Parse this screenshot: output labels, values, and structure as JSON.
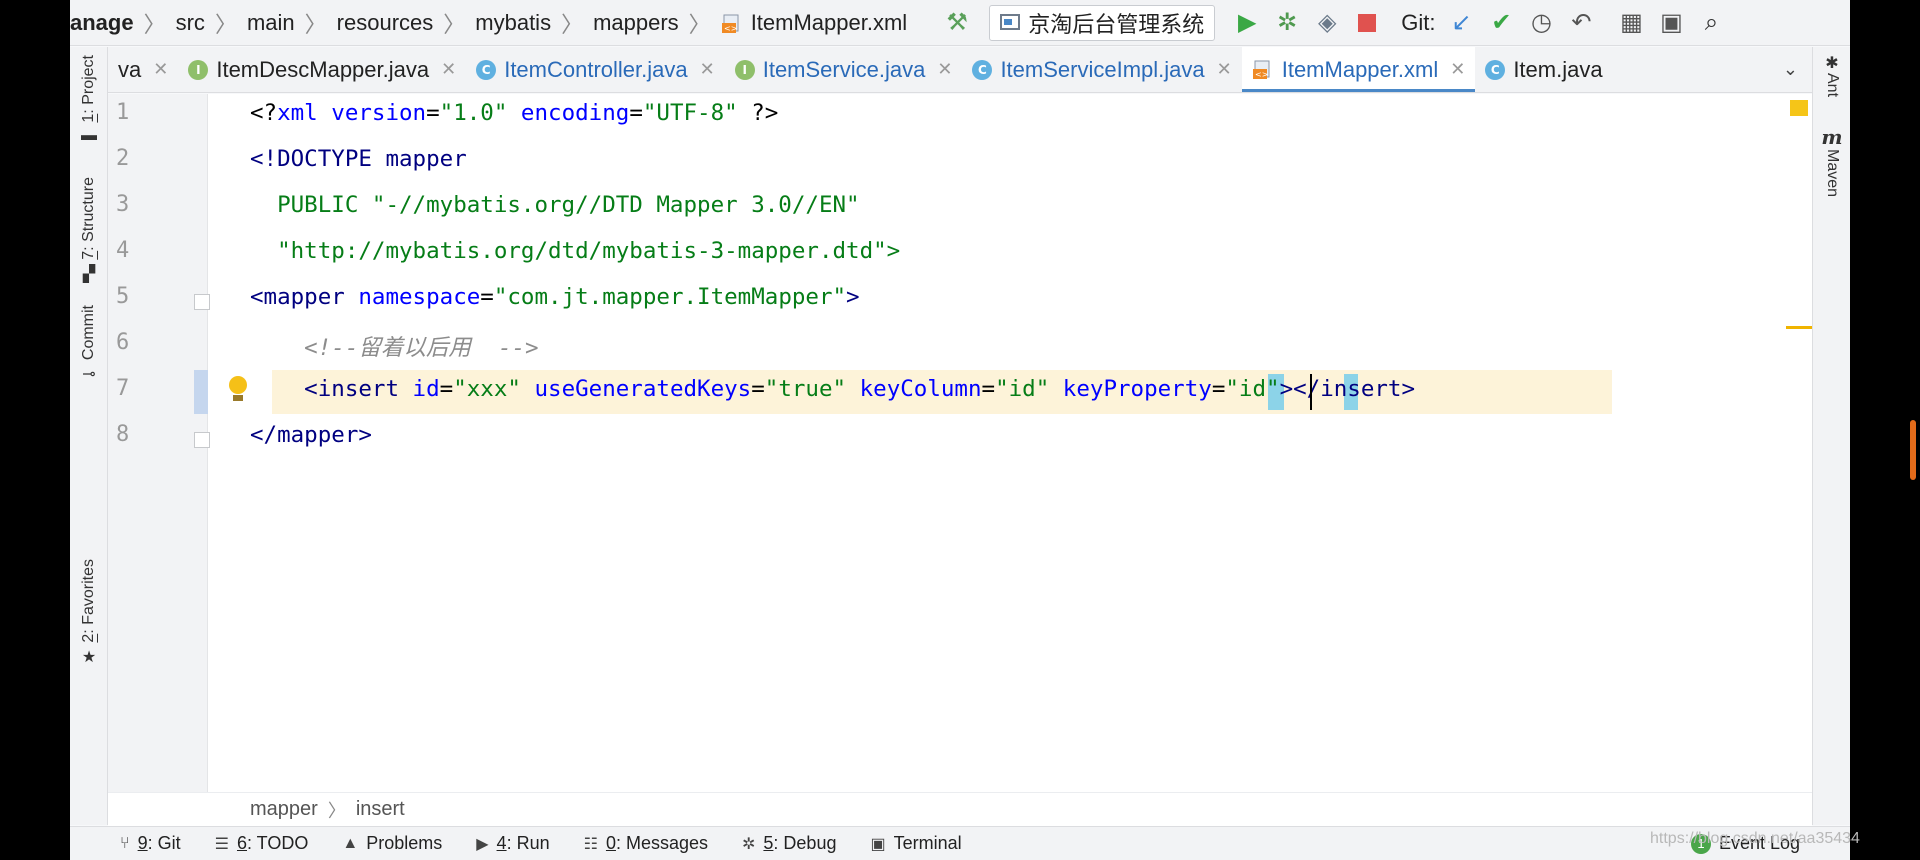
{
  "breadcrumb": [
    "anage",
    "src",
    "main",
    "resources",
    "mybatis",
    "mappers",
    "ItemMapper.xml"
  ],
  "run_config": "京淘后台管理系统",
  "git_label": "Git:",
  "left_tools": [
    {
      "num": "1",
      "label": ": Project"
    },
    {
      "num": "7",
      "label": ": Structure"
    },
    {
      "num": "",
      "label": "Commit"
    },
    {
      "num": "2",
      "label": ": Favorites"
    }
  ],
  "right_tools": [
    "Ant",
    "Maven"
  ],
  "tabs": [
    {
      "label": "va",
      "icon": "",
      "active": false
    },
    {
      "label": "ItemDescMapper.java",
      "icon": "I",
      "active": false
    },
    {
      "label": "ItemController.java",
      "icon": "C",
      "active": false
    },
    {
      "label": "ItemService.java",
      "icon": "I",
      "active": false
    },
    {
      "label": "ItemServiceImpl.java",
      "icon": "C",
      "active": false
    },
    {
      "label": "ItemMapper.xml",
      "icon": "xml",
      "active": true
    },
    {
      "label": "Item.java",
      "icon": "C",
      "active": false
    }
  ],
  "line_numbers": [
    "1",
    "2",
    "3",
    "4",
    "5",
    "6",
    "7",
    "8"
  ],
  "code": {
    "l1": {
      "a": "<?",
      "b": "xml",
      "c": " version",
      "d": "=",
      "e": "\"1.0\"",
      "f": " encoding",
      "g": "=",
      "h": "\"UTF-8\"",
      "i": " ?>"
    },
    "l2": "<!DOCTYPE mapper",
    "l3": "  PUBLIC \"-//mybatis.org//DTD Mapper 3.0//EN\"",
    "l4": "  \"http://mybatis.org/dtd/mybatis-3-mapper.dtd\">",
    "l5": {
      "a": "<mapper",
      "b": " namespace",
      "c": "=",
      "d": "\"com.jt.mapper.ItemMapper\"",
      "e": ">"
    },
    "l6": "    <!--留着以后用  -->",
    "l7": {
      "a": "    <insert",
      "b": " id",
      "c": "=",
      "d": "\"xxx\"",
      "e": " useGeneratedKeys",
      "f": "=",
      "g": "\"true\"",
      "h": " keyColumn",
      "i": "=",
      "j": "\"id\"",
      "k": " keyProperty",
      "l": "=",
      "m": "\"id\"",
      "n": "></insert>"
    },
    "l8": "</mapper>"
  },
  "editor_breadcrumb": [
    "mapper",
    "insert"
  ],
  "bottom_tools": [
    {
      "num": "9",
      "label": ": Git",
      "icon": "git-branch-icon"
    },
    {
      "num": "6",
      "label": ": TODO",
      "icon": "list-icon"
    },
    {
      "num": "",
      "label": "Problems",
      "icon": "warning-icon"
    },
    {
      "num": "4",
      "label": ": Run",
      "icon": "play-icon"
    },
    {
      "num": "0",
      "label": ": Messages",
      "icon": "messages-icon"
    },
    {
      "num": "5",
      "label": ": Debug",
      "icon": "bug-icon"
    },
    {
      "num": "",
      "label": "Terminal",
      "icon": "terminal-icon"
    }
  ],
  "event_log": {
    "count": "1",
    "label": "Event Log"
  },
  "watermark": "https://blog.csdn.net/aa35434"
}
